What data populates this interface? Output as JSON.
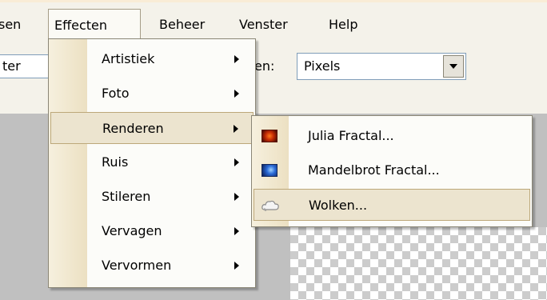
{
  "menubar": {
    "items": [
      {
        "label": "sen"
      },
      {
        "label": "Effecten",
        "active": true
      },
      {
        "label": "Beheer"
      },
      {
        "label": "Venster"
      },
      {
        "label": "Help"
      }
    ]
  },
  "toolbar": {
    "left_field_text": "ter",
    "units_label": "eden:",
    "units_select_value": "Pixels"
  },
  "effects_menu": {
    "items": [
      {
        "label": "Artistiek",
        "has_submenu": true
      },
      {
        "label": "Foto",
        "has_submenu": true
      },
      {
        "label": "Renderen",
        "has_submenu": true,
        "highlighted": true
      },
      {
        "label": "Ruis",
        "has_submenu": true
      },
      {
        "label": "Stileren",
        "has_submenu": true
      },
      {
        "label": "Vervagen",
        "has_submenu": true
      },
      {
        "label": "Vervormen",
        "has_submenu": true
      }
    ]
  },
  "render_submenu": {
    "items": [
      {
        "label": "Julia Fractal...",
        "icon": "julia-fractal-icon"
      },
      {
        "label": "Mandelbrot Fractal...",
        "icon": "mandelbrot-fractal-icon"
      },
      {
        "label": "Wolken...",
        "icon": "clouds-icon",
        "highlighted": true
      }
    ]
  },
  "colors": {
    "menu_highlight": "#ece4cf",
    "menu_border": "#8a8676",
    "workspace": "#c0c0c0"
  }
}
